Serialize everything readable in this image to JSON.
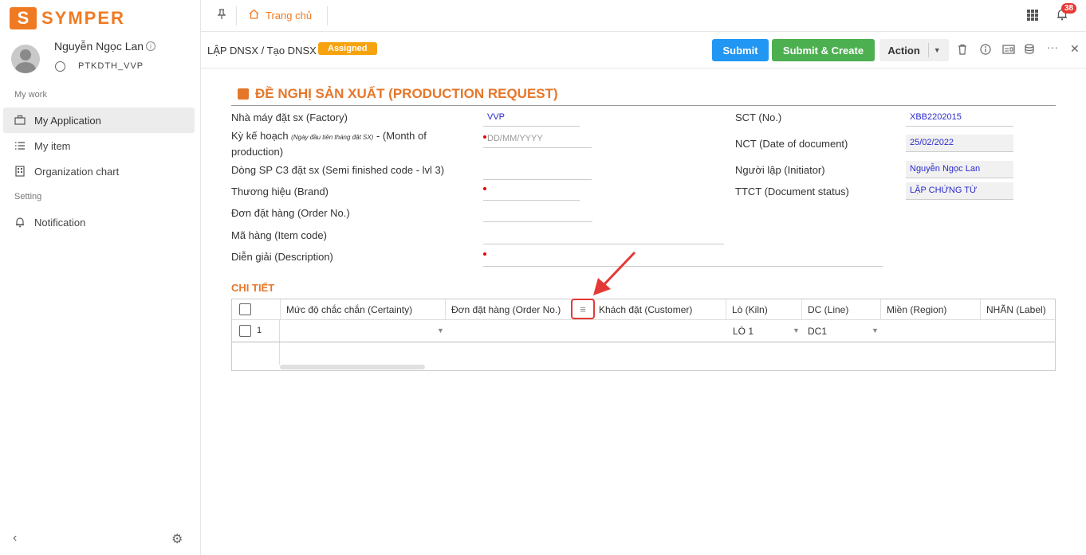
{
  "brand": {
    "logo_letter": "S",
    "name": "SYMPER",
    "color": "#f07a22"
  },
  "user": {
    "name": "Nguyễn Ngọc Lan",
    "role": "PTKDTH_VVP"
  },
  "sidebar": {
    "section_work": "My work",
    "items": [
      {
        "label": "My Application",
        "icon": "briefcase-icon",
        "active": true
      },
      {
        "label": "My item",
        "icon": "list-icon",
        "active": false
      },
      {
        "label": "Organization chart",
        "icon": "org-chart-icon",
        "active": false
      }
    ],
    "section_setting": "Setting",
    "settings_items": [
      {
        "label": "Notification",
        "icon": "bell-icon"
      }
    ]
  },
  "topbar": {
    "home_tab": "Trang chủ",
    "notification_count": "38"
  },
  "toolbar": {
    "breadcrumb": "LẬP DNSX / Tạo DNSX",
    "status": "Assigned",
    "submit_label": "Submit",
    "submit_create_label": "Submit & Create",
    "action_label": "Action",
    "colors": {
      "submit": "#2196f3",
      "submit_create": "#4caf50",
      "status": "#f7a20f"
    }
  },
  "form": {
    "title": "ĐỀ NGHỊ SẢN XUẤT (PRODUCTION REQUEST)",
    "fields": {
      "factory_label": "Nhà máy đặt sx (Factory)",
      "factory_value": "VVP",
      "plan_label_a": "Kỳ kế hoạch",
      "plan_label_small": "(Ngày đầu tiên tháng đặt SX)",
      "plan_label_b": "- (Month of production)",
      "plan_placeholder": "DD/MM/YYYY",
      "semi_label": "Dòng SP C3 đặt sx (Semi finished code - lvl 3)",
      "brand_label": "Thương hiệu (Brand)",
      "order_label": "Đơn đặt hàng (Order No.)",
      "item_label": "Mã hàng (Item code)",
      "desc_label": "Diễn giải (Description)",
      "sct_label": "SCT (No.)",
      "sct_value": "XBB2202015",
      "nct_label": "NCT (Date of document)",
      "nct_value": "25/02/2022",
      "initiator_label": "Người lập (Initiator)",
      "initiator_value": "Nguyễn Ngọc Lan",
      "ttct_label": "TTCT (Document status)",
      "ttct_value": "LẬP CHỨNG TỪ"
    },
    "detail_title": "CHI TIẾT",
    "table": {
      "columns": [
        "Mức độ chắc chắn (Certainty)",
        "Đơn đặt hàng (Order No.)",
        "Khách đặt (Customer)",
        "Lò (Kiln)",
        "DC (Line)",
        "Miền (Region)",
        "NHÃN (Label)"
      ],
      "rows": [
        {
          "index": "1",
          "certainty": "",
          "order": "",
          "customer": "",
          "kiln": "LÒ 1",
          "line": "DC1",
          "region": "",
          "label": ""
        }
      ]
    }
  }
}
